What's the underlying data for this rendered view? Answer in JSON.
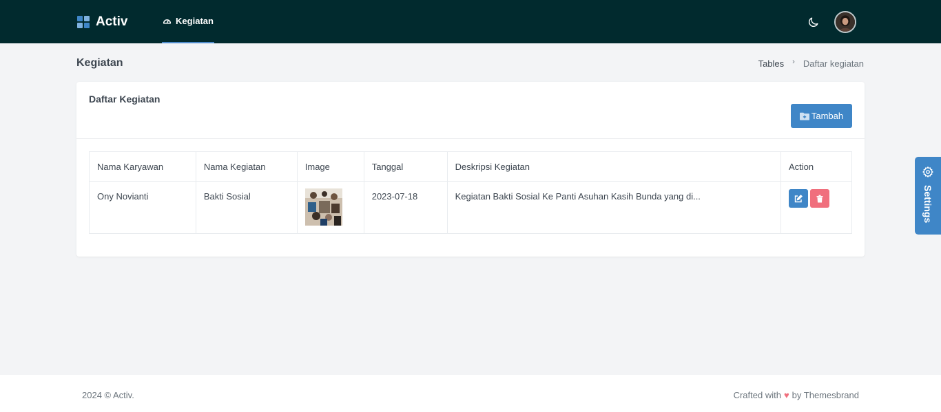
{
  "header": {
    "brand": "Activ",
    "nav_item": "Kegiatan",
    "brand_colors": [
      "#3f86c7",
      "#7fb2e0",
      "#7fb2e0",
      "#3f86c7"
    ]
  },
  "page": {
    "title": "Kegiatan",
    "breadcrumb": [
      "Tables",
      "Daftar kegiatan"
    ]
  },
  "card": {
    "title": "Daftar Kegiatan",
    "add_button": "Tambah"
  },
  "table": {
    "columns": [
      "Nama Karyawan",
      "Nama Kegiatan",
      "Image",
      "Tanggal",
      "Deskripsi Kegiatan",
      "Action"
    ],
    "rows": [
      {
        "nama_karyawan": "Ony Novianti",
        "nama_kegiatan": "Bakti Sosial",
        "tanggal": "2023-07-18",
        "deskripsi": "Kegiatan Bakti Sosial Ke Panti Asuhan Kasih Bunda yang di..."
      }
    ]
  },
  "settings_tab": {
    "label": "Settings"
  },
  "footer": {
    "left": "2024 © Activ.",
    "right_prefix": "Crafted with",
    "right_suffix": "by Themesbrand"
  },
  "colors": {
    "topbar": "#012a2e",
    "primary": "#3f86c7",
    "danger": "#f06f7d"
  }
}
